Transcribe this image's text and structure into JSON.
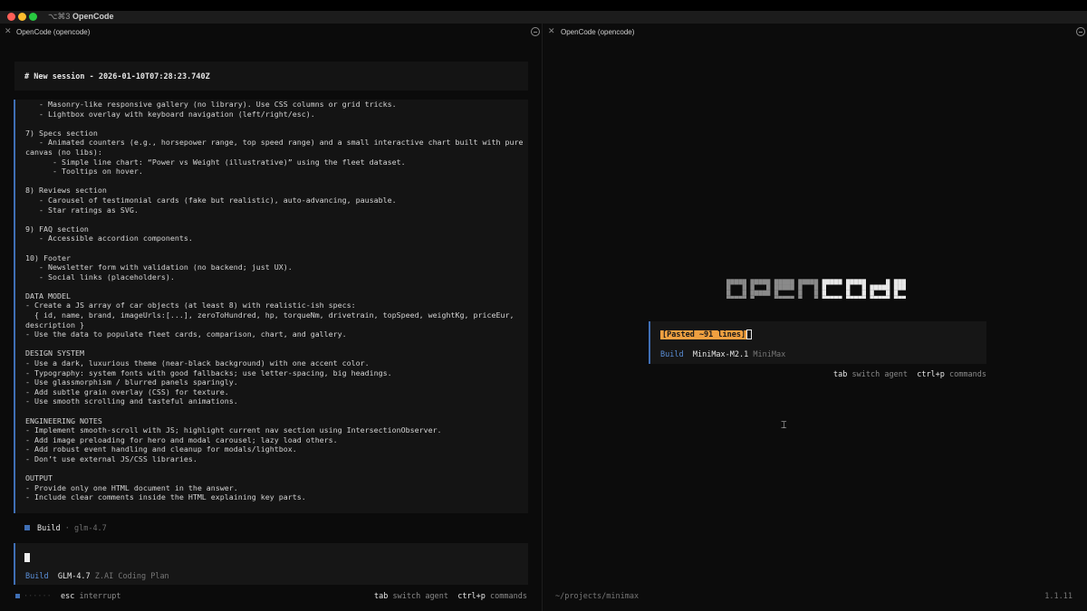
{
  "window": {
    "shortcut": "⌥⌘3",
    "title": "OpenCode"
  },
  "left_pane": {
    "title": "OpenCode (opencode)",
    "session_title": "# New session - 2026-01-10T07:28:23.740Z",
    "prompt_lines": [
      "   - Masonry-like responsive gallery (no library). Use CSS columns or grid tricks.",
      "   - Lightbox overlay with keyboard navigation (left/right/esc).",
      "",
      "7) Specs section",
      "   - Animated counters (e.g., horsepower range, top speed range) and a small interactive chart built with pure",
      "canvas (no libs):",
      "      - Simple line chart: “Power vs Weight (illustrative)” using the fleet dataset.",
      "      - Tooltips on hover.",
      "",
      "8) Reviews section",
      "   - Carousel of testimonial cards (fake but realistic), auto-advancing, pausable.",
      "   - Star ratings as SVG.",
      "",
      "9) FAQ section",
      "   - Accessible accordion components.",
      "",
      "10) Footer",
      "   - Newsletter form with validation (no backend; just UX).",
      "   - Social links (placeholders).",
      "",
      "DATA MODEL",
      "- Create a JS array of car objects (at least 8) with realistic-ish specs:",
      "  { id, name, brand, imageUrls:[...], zeroToHundred, hp, torqueNm, drivetrain, topSpeed, weightKg, priceEur,",
      "description }",
      "- Use the data to populate fleet cards, comparison, chart, and gallery.",
      "",
      "DESIGN SYSTEM",
      "- Use a dark, luxurious theme (near-black background) with one accent color.",
      "- Typography: system fonts with good fallbacks; use letter-spacing, big headings.",
      "- Use glassmorphism / blurred panels sparingly.",
      "- Add subtle grain overlay (CSS) for texture.",
      "- Use smooth scrolling and tasteful animations.",
      "",
      "ENGINEERING NOTES",
      "- Implement smooth-scroll with JS; highlight current nav section using IntersectionObserver.",
      "- Add image preloading for hero and modal carousel; lazy load others.",
      "- Add robust event handling and cleanup for modals/lightbox.",
      "- Don’t use external JS/CSS libraries.",
      "",
      "OUTPUT",
      "- Provide only one HTML document in the answer.",
      "- Include clear comments inside the HTML explaining key parts."
    ],
    "build_label": "Build",
    "build_sep": "·",
    "build_model": "glm-4.7",
    "input": {
      "agent": "Build",
      "model": "GLM-4.7",
      "provider": "Z.AI Coding Plan"
    },
    "status": {
      "dots": "······",
      "esc_key": "esc",
      "esc_hint": "interrupt",
      "tab_key": "tab",
      "tab_hint": "switch agent",
      "cmd_key": "ctrl+p",
      "cmd_hint": "commands"
    }
  },
  "right_pane": {
    "title": "OpenCode (opencode)",
    "logo_text": "opencode",
    "pasted_badge": "[Pasted ~91 lines]",
    "input": {
      "agent": "Build",
      "model": "MiniMax-M2.1",
      "provider": "MiniMax"
    },
    "hints": {
      "tab_key": "tab",
      "tab_hint": "switch agent",
      "cmd_key": "ctrl+p",
      "cmd_hint": "commands"
    },
    "path": "~/projects/minimax",
    "version": "1.1.11"
  },
  "colors": {
    "accent_blue": "#3f6fb5",
    "paste_orange": "#f0a040",
    "logo_dim": "#8a8a8a",
    "logo_bright": "#e8e8e8"
  }
}
